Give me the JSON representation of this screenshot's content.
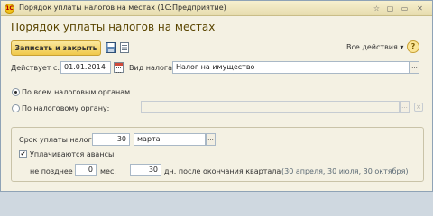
{
  "window": {
    "title": "Порядок уплаты налогов на местах",
    "app": "(1С:Предприятие)",
    "logo": "1С",
    "controls": [
      "☆",
      "▢",
      "▭",
      "✕"
    ]
  },
  "form": {
    "title": "Порядок уплаты налогов на местах",
    "save_close_label": "Записать и закрыть",
    "all_actions_label": "Все действия ▾",
    "help_label": "?"
  },
  "effective": {
    "label": "Действует с:",
    "value": "01.01.2014"
  },
  "tax_type": {
    "label": "Вид налога:",
    "value": "Налог на имущество",
    "button": "..."
  },
  "scope": {
    "option_all": "По всем налоговым органам",
    "option_one": "По налоговому органу:",
    "authority_value": "",
    "button": "...",
    "clear": "×",
    "selected": "all"
  },
  "payment": {
    "deadline_label": "Срок уплаты налога:",
    "day": "30",
    "month": "марта",
    "month_button": "...",
    "advances_label": "Уплачиваются авансы",
    "advances_checked": true,
    "not_later_label": "не позднее",
    "months_value": "0",
    "months_label": "мес.",
    "days_value": "30",
    "days_label": "дн. после окончания квартала",
    "dates_hint": "(30 апреля, 30 июля, 30 октября)"
  }
}
